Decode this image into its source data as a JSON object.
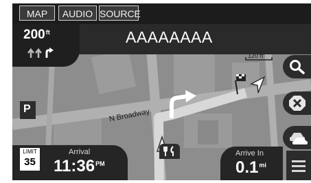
{
  "tabs": {
    "map": "MAP",
    "audio": "AUDIO",
    "source": "SOURCE"
  },
  "next_street": "AAAAAAAA",
  "next_turn": {
    "distance": "200",
    "unit": "ft"
  },
  "map": {
    "road_label": "N Broadway",
    "scale_label": "120 ft",
    "parking_label": "P"
  },
  "speed_limit": {
    "label": "LIMIT",
    "value": "35"
  },
  "arrival": {
    "label": "Arrival",
    "time": "11:36",
    "suffix": "PM"
  },
  "arrive_in": {
    "label": "Arrive In",
    "value": "0.1",
    "unit": "mi"
  },
  "colors": {
    "map_background": "#8d8d8d",
    "road": "#b3b3b3",
    "building": "#a0a0a0",
    "route": "#ffffff"
  },
  "icons": [
    "search-icon",
    "cancel-route-icon",
    "traffic-icon",
    "menu-icon",
    "lane-arrows-icon",
    "food-icon",
    "destination-flag-icon",
    "vehicle-arrow-icon",
    "turn-right-arrow-icon"
  ]
}
